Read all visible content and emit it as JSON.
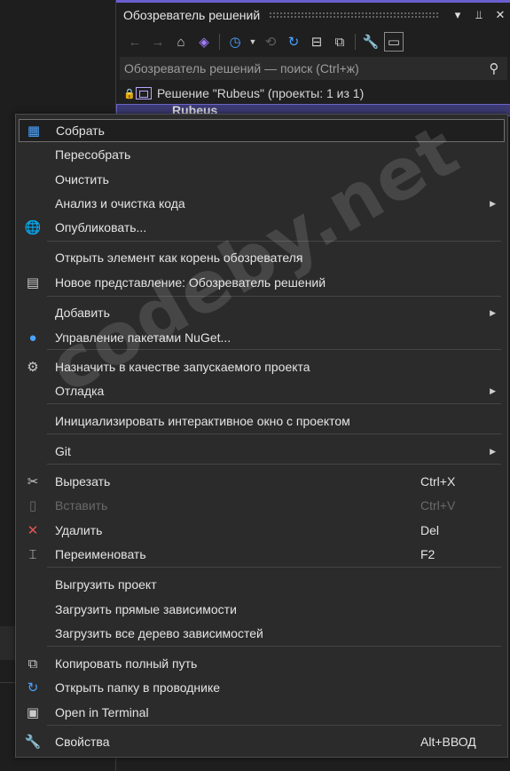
{
  "panel": {
    "title": "Обозреватель решений",
    "title_buttons": [
      "▼",
      "⊥",
      "✕"
    ],
    "search_placeholder": "Обозреватель решений — поиск (Ctrl+ж)"
  },
  "tree": {
    "solution": "Решение \"Rubeus\" (проекты: 1 из 1)",
    "project": "Rubeus"
  },
  "menu": [
    {
      "label": "Собрать",
      "icon": "build-icon",
      "glyph": "▦",
      "hover": true
    },
    {
      "label": "Пересобрать"
    },
    {
      "label": "Очистить"
    },
    {
      "label": "Анализ и очистка кода",
      "submenu": true
    },
    {
      "label": "Опубликовать...",
      "icon": "publish-globe-icon",
      "glyph": "🌐"
    },
    {
      "label": "Открыть элемент как корень обозревателя"
    },
    {
      "label": "Новое представление: Обозреватель решений",
      "icon": "new-view-icon",
      "glyph": "▤"
    },
    {
      "label": "Добавить",
      "submenu": true
    },
    {
      "label": "Управление пакетами NuGet...",
      "icon": "nuget-icon",
      "glyph": "●"
    },
    {
      "label": "Назначить в качестве запускаемого проекта",
      "icon": "gear-icon",
      "glyph": "⚙"
    },
    {
      "label": "Отладка",
      "submenu": true
    },
    {
      "label": "Инициализировать интерактивное окно с проектом"
    },
    {
      "label": "Git",
      "submenu": true
    },
    {
      "label": "Вырезать",
      "icon": "scissors-icon",
      "glyph": "✂",
      "shortcut": "Ctrl+X"
    },
    {
      "label": "Вставить",
      "icon": "paste-icon",
      "glyph": "▯",
      "shortcut": "Ctrl+V",
      "disabled": true
    },
    {
      "label": "Удалить",
      "icon": "delete-x-icon",
      "glyph": "✕",
      "shortcut": "Del"
    },
    {
      "label": "Переименовать",
      "icon": "rename-icon",
      "glyph": "⌶",
      "shortcut": "F2"
    },
    {
      "label": "Выгрузить проект"
    },
    {
      "label": "Загрузить прямые зависимости"
    },
    {
      "label": "Загрузить все дерево зависимостей"
    },
    {
      "label": "Копировать полный путь",
      "icon": "copy-icon",
      "glyph": "⧉"
    },
    {
      "label": "Открыть папку в проводнике",
      "icon": "open-folder-arrow-icon",
      "glyph": "↻"
    },
    {
      "label": "Open in Terminal",
      "icon": "terminal-icon",
      "glyph": "▣"
    },
    {
      "label": "Свойства",
      "icon": "wrench-icon",
      "glyph": "🔧",
      "shortcut": "Alt+ВВОД"
    }
  ],
  "watermark": "codeby.net",
  "colors": {
    "accent": "#6b5fd0",
    "menu_bg": "#2b2b2b",
    "selection": "#3c3a72",
    "delete_red": "#e05555",
    "blue_icon": "#4aa3ff"
  }
}
